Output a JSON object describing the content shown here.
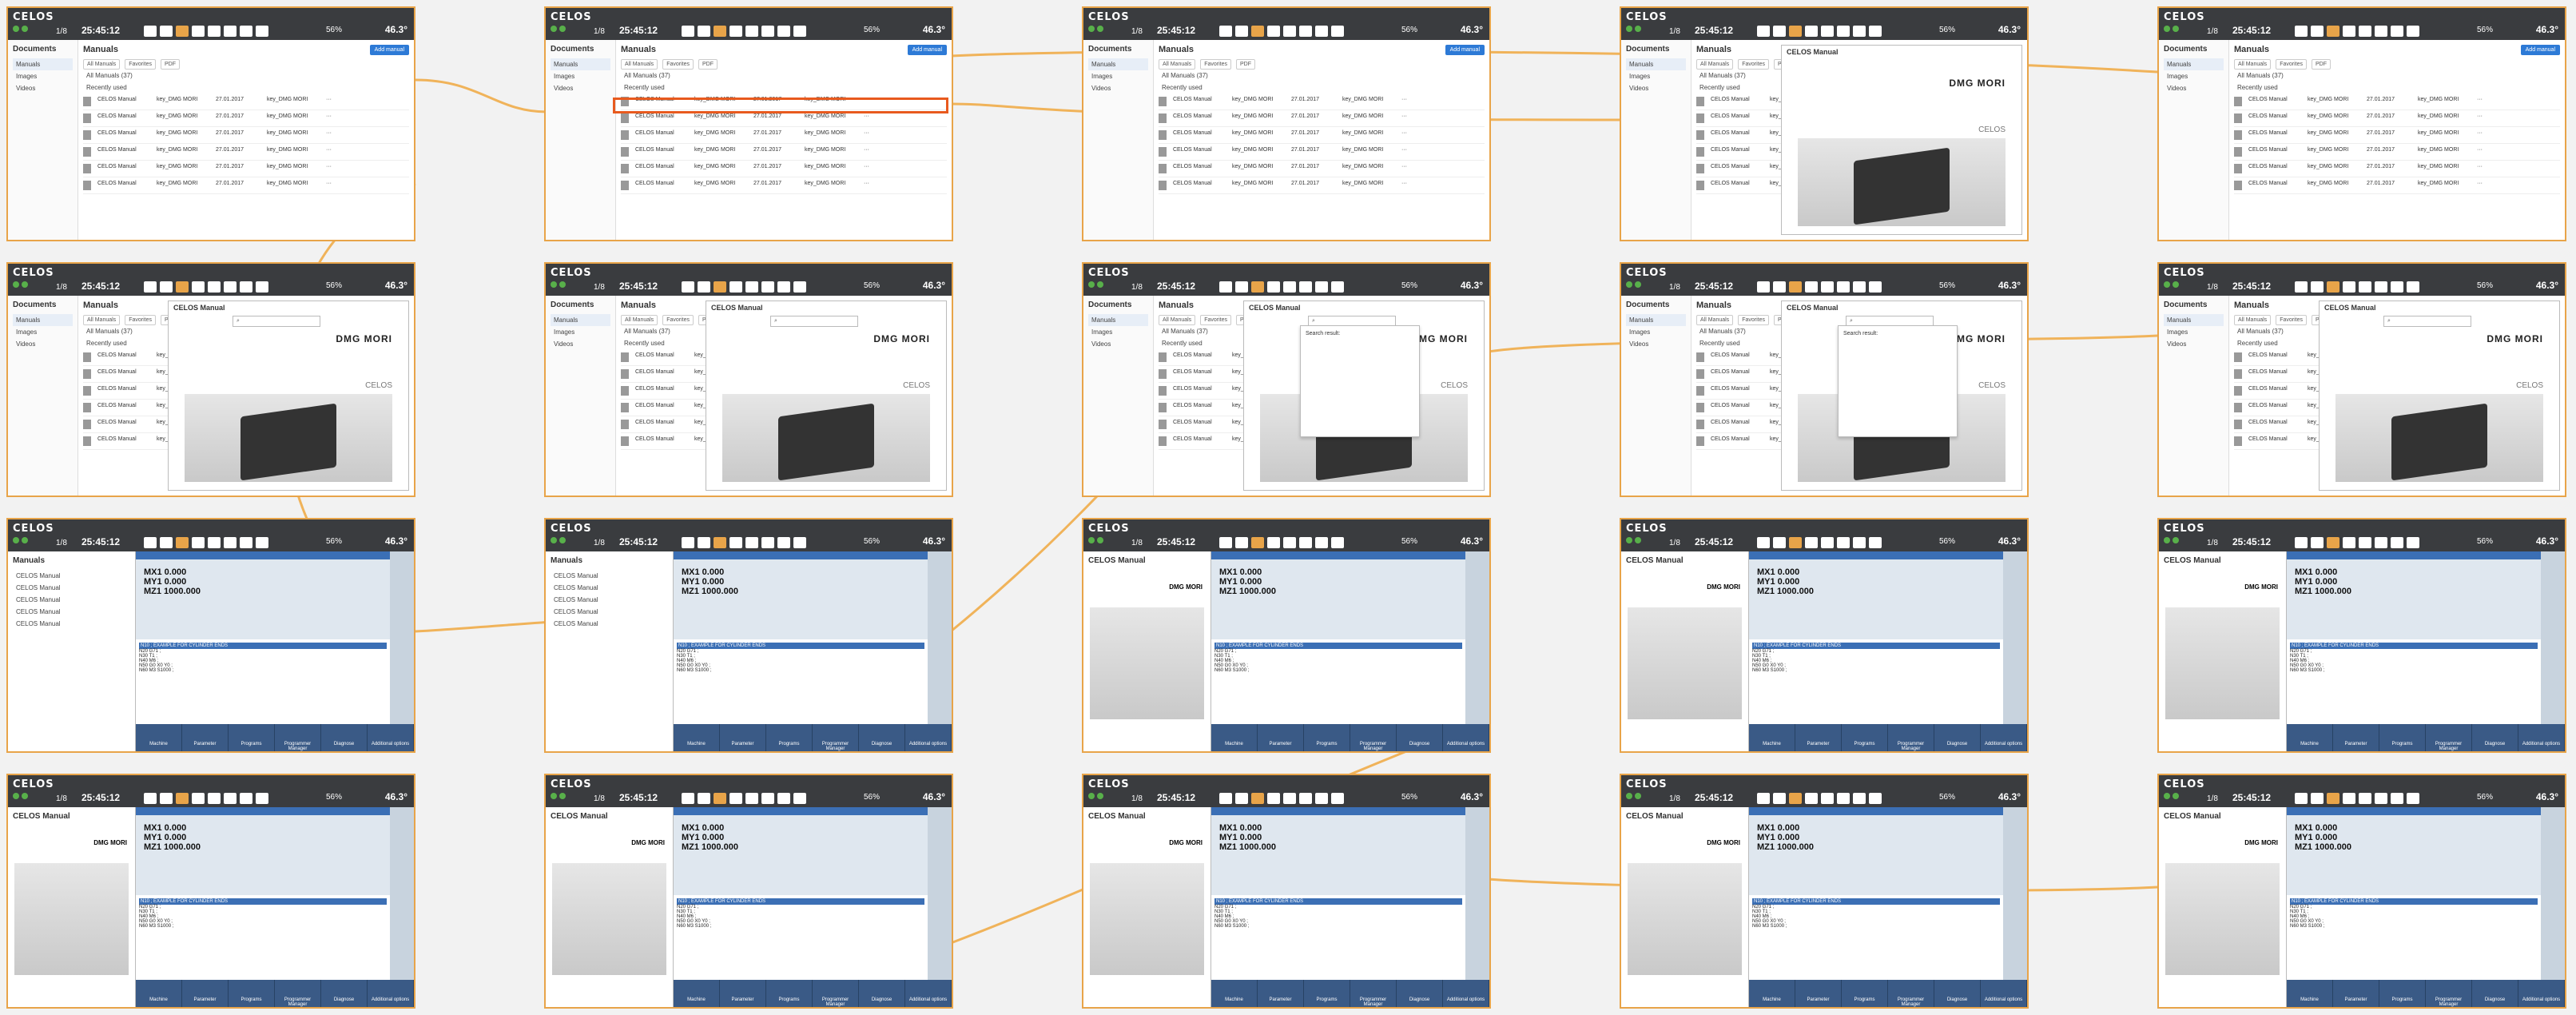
{
  "app": {
    "logo": "CELOS",
    "clock": "25:45:12",
    "shift": "1/8",
    "load_pct": "56%",
    "temp": "46.3°"
  },
  "labels": {
    "documents": "Documents",
    "manuals": "Manuals",
    "celos_manual": "CELOS Manual",
    "dmg_mori": "DMG MORI",
    "celos_brand": "CELOS",
    "search_results": "Search result:",
    "add_manual": "Add manual",
    "all_manuals": "All Manuals (37)",
    "recently_used": "Recently used"
  },
  "sidebar": [
    "Manuals",
    "Images",
    "Videos"
  ],
  "filters": [
    "All Manuals",
    "Favorites",
    "PDF"
  ],
  "manual_rows": [
    [
      "CELOS Manual",
      "key_DMG MORI",
      "27.01.2017",
      "key_DMG MORI"
    ],
    [
      "CELOS Manual",
      "key_DMG MORI",
      "27.01.2017",
      "key_DMG MORI"
    ],
    [
      "CELOS Manual",
      "key_DMG MORI",
      "27.01.2017",
      "key_DMG MORI"
    ],
    [
      "CELOS Manual",
      "key_DMG MORI",
      "27.01.2017",
      "key_DMG MORI"
    ],
    [
      "CELOS Manual",
      "key_DMG MORI",
      "27.01.2017",
      "key_DMG MORI"
    ],
    [
      "CELOS Manual",
      "key_DMG MORI",
      "27.01.2017",
      "key_DMG MORI"
    ]
  ],
  "cnc": {
    "axes": [
      "MX1  0.000",
      "MY1  0.000",
      "MZ1 1000.000"
    ],
    "program": [
      "N10 ; EXAMPLE FOR CYLINDER ENDS",
      "N20 G71 ;",
      "N30 T1 ;",
      "N40 M6 ;",
      "N50 G0 X0 Y0 ;",
      "N60 M3 S1000 ;"
    ],
    "footer": [
      "Machine",
      "Parameter",
      "Programs",
      "Programmer Manager",
      "Diagnose",
      "Additional options"
    ]
  }
}
